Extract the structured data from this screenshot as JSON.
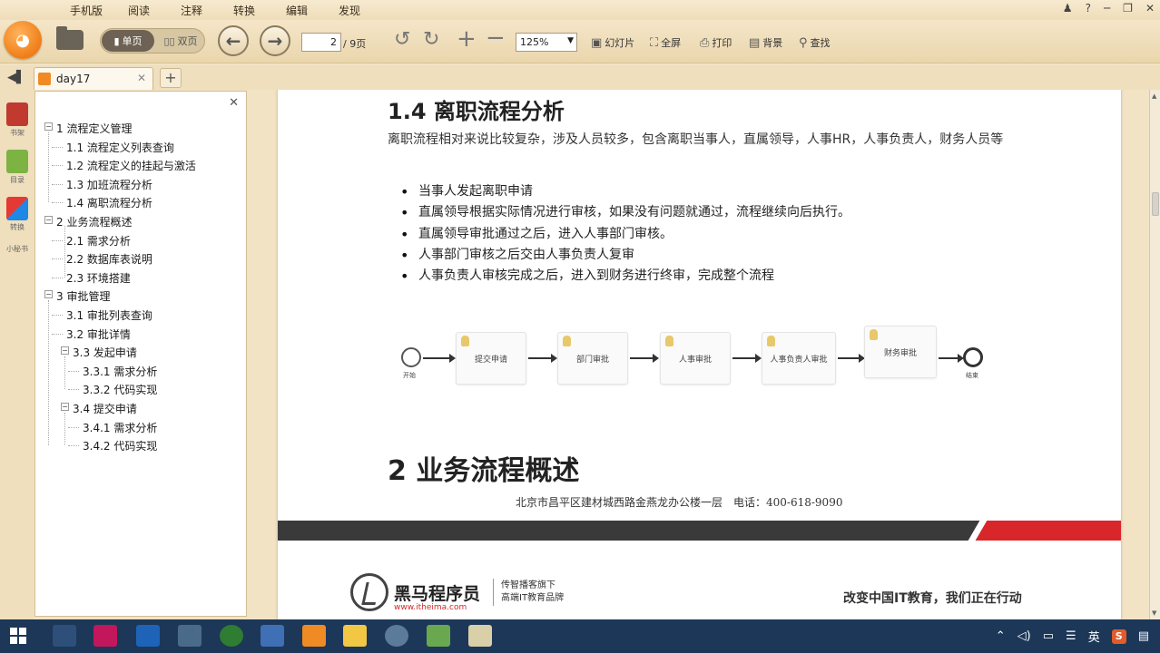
{
  "menu": [
    "手机版",
    "阅读",
    "注释",
    "转换",
    "编辑",
    "发现"
  ],
  "window_controls": [
    "♟",
    "?",
    "─",
    "❐",
    "✕"
  ],
  "toolbar": {
    "single_label": "单页",
    "double_label": "双页",
    "page_current": "2",
    "page_total": "/ 9页",
    "zoom": "125%",
    "slideshow": "幻灯片",
    "fullscreen": "全屏",
    "print": "打印",
    "background": "背景",
    "search": "查找"
  },
  "tab": {
    "title": "day17",
    "close": "✕",
    "add": "+"
  },
  "rail": [
    "书架",
    "目录",
    "转换",
    "小秘书"
  ],
  "outline": [
    {
      "label": "1 流程定义管理",
      "toggle": "−"
    },
    {
      "label": "1.1 流程定义列表查询"
    },
    {
      "label": "1.2 流程定义的挂起与激活"
    },
    {
      "label": "1.3 加班流程分析"
    },
    {
      "label": "1.4 离职流程分析"
    },
    {
      "label": "2 业务流程概述",
      "toggle": "−"
    },
    {
      "label": "2.1 需求分析"
    },
    {
      "label": "2.2 数据库表说明"
    },
    {
      "label": "2.3 环境搭建"
    },
    {
      "label": "3 审批管理",
      "toggle": "−"
    },
    {
      "label": "3.1 审批列表查询"
    },
    {
      "label": "3.2 审批详情"
    },
    {
      "label": "3.3 发起申请",
      "toggle": "−"
    },
    {
      "label": "3.3.1 需求分析"
    },
    {
      "label": "3.3.2 代码实现"
    },
    {
      "label": "3.4 提交申请",
      "toggle": "−"
    },
    {
      "label": "3.4.1 需求分析"
    },
    {
      "label": "3.4.2 代码实现"
    }
  ],
  "document": {
    "section_title": "1.4 离职流程分析",
    "paragraph": "离职流程相对来说比较复杂，涉及人员较多，包含离职当事人，直属领导，人事HR，人事负责人，财务人员等",
    "bullets": [
      "当事人发起离职申请",
      "直属领导根据实际情况进行审核，如果没有问题就通过，流程继续向后执行。",
      "直属领导审批通过之后，进入人事部门审核。",
      "人事部门审核之后交由人事负责人复审",
      "人事负责人审核完成之后，进入到财务进行终审，完成整个流程"
    ],
    "flow": {
      "start": "开始",
      "end": "结束",
      "tasks": [
        "提交申请",
        "部门审批",
        "人事审批",
        "人事负责人审批",
        "财务审批"
      ]
    },
    "section2_title": "2 业务流程概述",
    "footer_address": "北京市昌平区建材城西路金燕龙办公楼一层　电话：400-618-9090",
    "brand_name": "黑马程序员",
    "brand_url": "www.itheima.com",
    "brand_slogan_1": "传智播客旗下",
    "brand_slogan_2": "高端IT教育品牌",
    "footer_motto": "改变中国IT教育，我们正在行动"
  },
  "tray": {
    "lang": "英",
    "s_badge": "S"
  },
  "colors": {
    "accent": "#f08a24",
    "footer_red": "#d9262a",
    "taskbar": "#1c3758"
  }
}
